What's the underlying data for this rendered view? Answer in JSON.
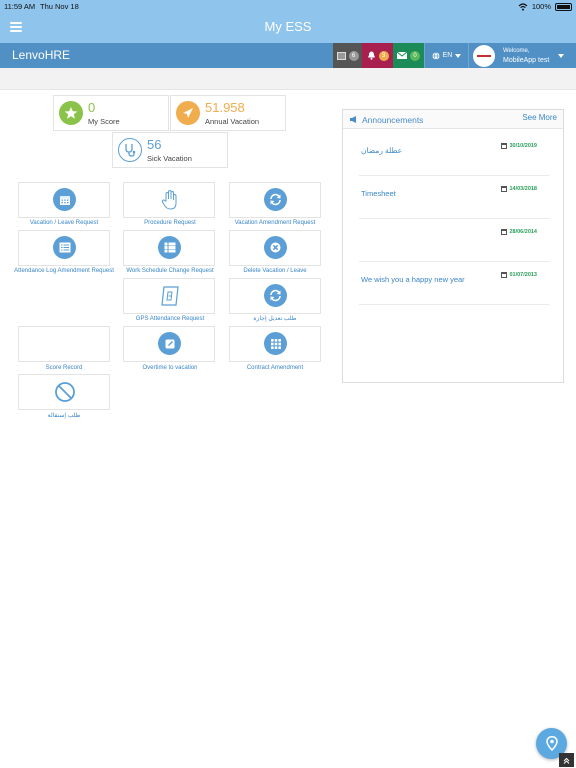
{
  "status_bar": {
    "time": "11:59 AM",
    "date": "Thu Nov 18",
    "battery": "100%"
  },
  "app": {
    "title": "My ESS",
    "brand": "LenvoHRE"
  },
  "header": {
    "messages_count": "6",
    "notifications_count": "3",
    "mail_count": "0",
    "language": "EN",
    "welcome_label": "Welcome,",
    "user_name": "MobileApp test"
  },
  "stats": [
    {
      "value": "0",
      "label": "My Score",
      "color": "#8bc34a",
      "icon": "star-icon"
    },
    {
      "value": "51.958",
      "label": "Annual Vacation",
      "color": "#f0ad4e",
      "icon": "airplane-icon"
    },
    {
      "value": "56",
      "label": "Sick Vacation",
      "color": "#5b9fd6",
      "icon": "stethoscope-icon"
    }
  ],
  "tiles": [
    "Vacation / Leave Request",
    "Procedure Request",
    "Vacation Amendment Request",
    "Attendance Log Amendment Request",
    "Work Schedule Change Request",
    "Delete Vacation / Leave",
    "GPS Attendance Request",
    "طلب تعديل إجازة",
    "Score Record",
    "Overtime to vacation",
    "Contract Amendment",
    "طلب إستقالة"
  ],
  "announcements": {
    "title": "Announcements",
    "see_more": "See More",
    "items": [
      {
        "text": "عطلة رمضان",
        "date": "30/10/2019"
      },
      {
        "text": "Timesheet",
        "date": "14/03/2018"
      },
      {
        "text": "",
        "date": "28/06/2014"
      },
      {
        "text": "We wish you a happy new year",
        "date": "01/07/2013"
      }
    ]
  },
  "colors": {
    "app_bar": "#8fc4ec",
    "header": "#5090c4",
    "link": "#3a86c8",
    "date_green": "#2aa05a"
  }
}
